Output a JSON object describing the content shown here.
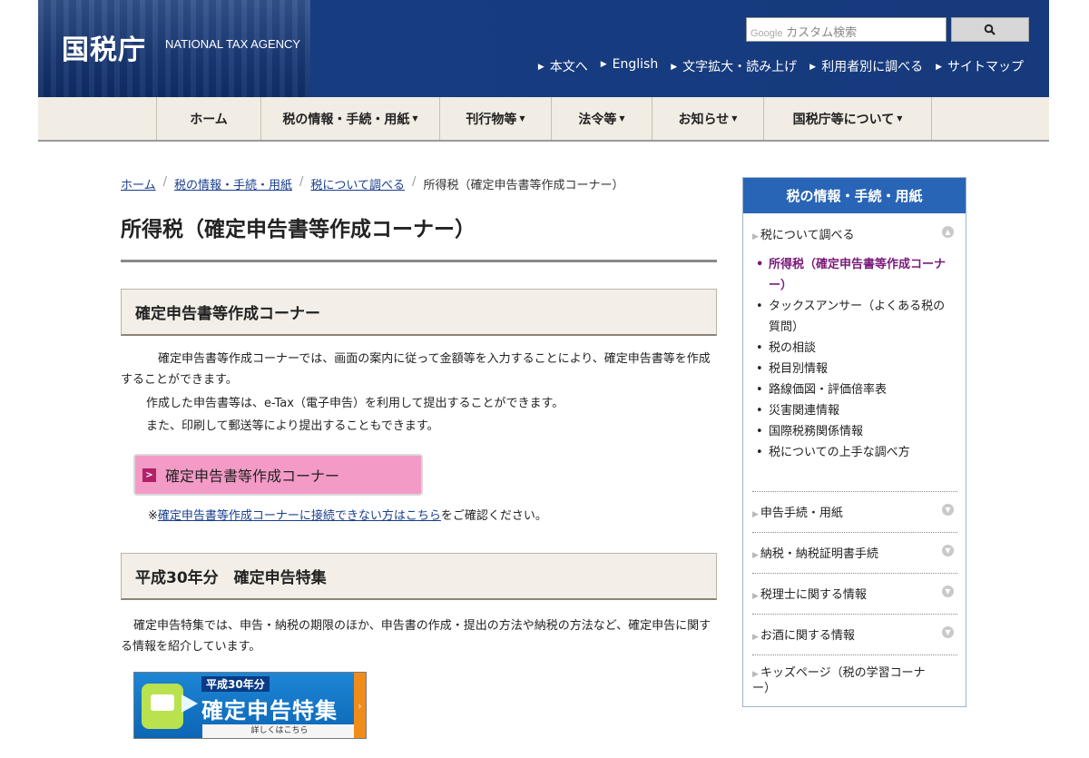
{
  "header": {
    "logo": "国税庁",
    "logo_en": "NATIONAL TAX AGENCY",
    "search_brand": "Google",
    "search_placeholder": "カスタム検索",
    "links": [
      "本文へ",
      "English",
      "文字拡大・読み上げ",
      "利用者別に調べる",
      "サイトマップ"
    ]
  },
  "nav": {
    "items": [
      {
        "label": "ホーム",
        "caret": false
      },
      {
        "label": "税の情報・手続・用紙",
        "caret": true
      },
      {
        "label": "刊行物等",
        "caret": true
      },
      {
        "label": "法令等",
        "caret": true
      },
      {
        "label": "お知らせ",
        "caret": true
      },
      {
        "label": "国税庁等について",
        "caret": true
      }
    ]
  },
  "breadcrumb": [
    "ホーム",
    "税の情報・手続・用紙",
    "税について調べる",
    "所得税（確定申告書等作成コーナー）"
  ],
  "main": {
    "title": "所得税（確定申告書等作成コーナー）",
    "section1": {
      "heading": "確定申告書等作成コーナー",
      "p1": "　確定申告書等作成コーナーでは、画面の案内に従って金額等を入力することにより、確定申告書等を作成することができます。",
      "p2": "作成した申告書等は、e-Tax（電子申告）を利用して提出することができます。",
      "p3": "また、印刷して郵送等により提出することもできます。",
      "button": "確定申告書等作成コーナー",
      "note_prefix": "※",
      "note_link": "確定申告書等作成コーナーに接続できない方はこちら",
      "note_suffix": "をご確認ください。"
    },
    "section2": {
      "heading": "平成30年分　確定申告特集",
      "p1": "確定申告特集では、申告・納税の期限のほか、申告書の作成・提出の方法や納税の方法など、確定申告に関する情報を紹介しています。",
      "banner_tag": "平成30年分",
      "banner_big": "確定申告特集",
      "banner_small": "詳しくはこちら"
    }
  },
  "sidebar": {
    "title": "税の情報・手続・用紙",
    "first": "税について調べる",
    "sub": [
      "所得税（確定申告書等作成コーナー）",
      "タックスアンサー（よくある税の質問）",
      "税の相談",
      "税目別情報",
      "路線価図・評価倍率表",
      "災害関連情報",
      "国際税務関係情報",
      "税についての上手な調べ方"
    ],
    "rows": [
      "申告手続・用紙",
      "納税・納税証明書手続",
      "税理士に関する情報",
      "お酒に関する情報",
      "キッズページ（税の学習コーナー）"
    ]
  }
}
